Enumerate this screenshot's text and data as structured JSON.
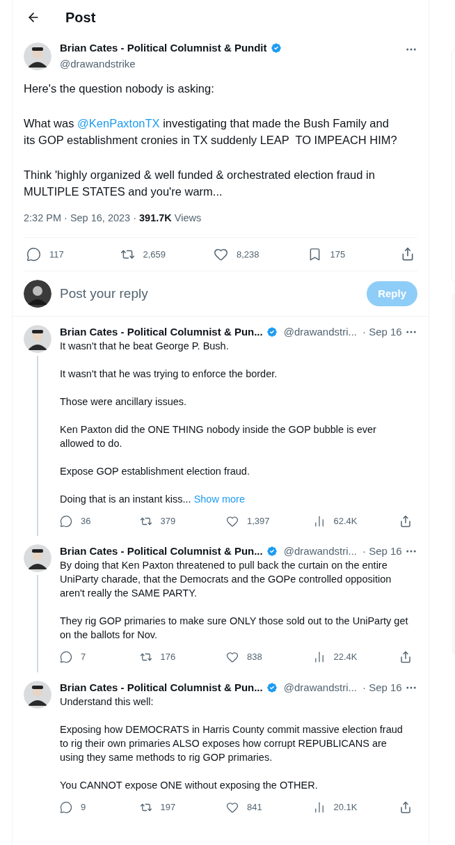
{
  "header": {
    "title": "Post"
  },
  "post": {
    "author": "Brian Cates - Political Columnist & Pundit",
    "verified": true,
    "handle": "@drawandstrike",
    "paragraphs": [
      [
        {
          "kind": "text",
          "text": "Here's the question nobody is asking:"
        }
      ],
      [
        {
          "kind": "text",
          "text": "What was "
        },
        {
          "kind": "mention",
          "text": "@KenPaxtonTX"
        },
        {
          "kind": "text",
          "text": " investigating that made the Bush Family and its GOP establishment cronies in TX suddenly LEAP  TO IMPEACH HIM?"
        }
      ],
      [
        {
          "kind": "text",
          "text": "Think 'highly organized & well funded & orchestrated election fraud in MULTIPLE STATES and you're warm..."
        }
      ]
    ],
    "time": "2:32 PM · Sep 16, 2023 · ",
    "views": "391.7K",
    "views_label": " Views",
    "stats": {
      "replies": "117",
      "reposts": "2,659",
      "likes": "8,238",
      "bookmarks": "175"
    }
  },
  "composer": {
    "placeholder": "Post your reply",
    "button": "Reply",
    "disabled": true
  },
  "replies": [
    {
      "author": "Brian Cates - Political Columnist & Pun...",
      "verified": true,
      "handle": "@drawandstri...",
      "date": "· Sep 16",
      "paragraphs": [
        "It wasn't that he beat George P. Bush.",
        "It wasn't that he was trying to enforce the border.",
        "Those were ancillary issues.",
        "Ken Paxton did the ONE THING nobody inside the GOP bubble is ever allowed to do.",
        "Expose GOP establishment election fraud.",
        "Doing that is an instant kiss..."
      ],
      "show_more": "Show more",
      "stats": {
        "replies": "36",
        "reposts": "379",
        "likes": "1,397",
        "views": "62.4K"
      }
    },
    {
      "author": "Brian Cates - Political Columnist & Pun...",
      "verified": true,
      "handle": "@drawandstri...",
      "date": "· Sep 16",
      "paragraphs": [
        "By doing that Ken Paxton threatened to pull back the curtain on the entire UniParty charade, that the Democrats and the GOPe controlled opposition aren't really the SAME PARTY.",
        "They rig GOP primaries to make sure ONLY those sold out to the UniParty get on the ballots for Nov."
      ],
      "stats": {
        "replies": "7",
        "reposts": "176",
        "likes": "838",
        "views": "22.4K"
      }
    },
    {
      "author": "Brian Cates - Political Columnist & Pun...",
      "verified": true,
      "handle": "@drawandstri...",
      "date": "· Sep 16",
      "paragraphs": [
        "Understand this well:",
        "Exposing how DEMOCRATS in Harris County commit massive election fraud to rig their own primaries ALSO exposes how corrupt REPUBLICANS are using they same methods to rig GOP primaries.",
        "You CANNOT expose ONE without exposing the OTHER."
      ],
      "stats": {
        "replies": "9",
        "reposts": "197",
        "likes": "841",
        "views": "20.1K"
      }
    }
  ]
}
